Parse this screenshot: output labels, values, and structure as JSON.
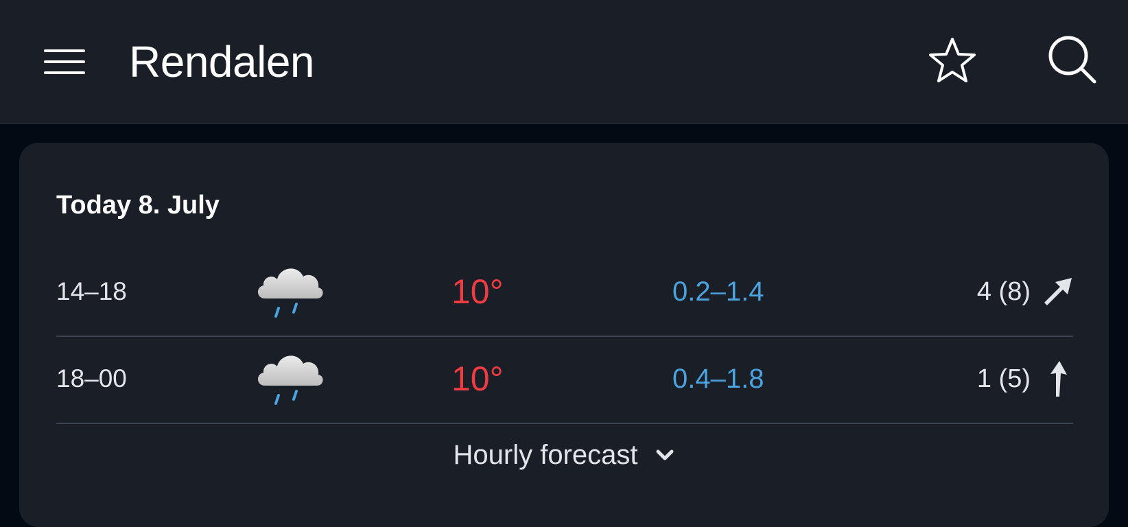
{
  "header": {
    "title": "Rendalen",
    "menu_icon": "hamburger-menu-icon",
    "favorite_icon": "star-outline-icon",
    "search_icon": "search-icon"
  },
  "forecast": {
    "day_title": "Today 8. July",
    "rows": [
      {
        "period": "14–18",
        "icon": "cloud-rain-icon",
        "temperature": "10°",
        "precipitation": "0.2–1.4",
        "wind": "4 (8)",
        "wind_direction": "north-east-arrow-icon"
      },
      {
        "period": "18–00",
        "icon": "cloud-rain-icon",
        "temperature": "10°",
        "precipitation": "0.4–1.8",
        "wind": "1 (5)",
        "wind_direction": "north-arrow-icon"
      }
    ],
    "hourly_label": "Hourly forecast",
    "hourly_icon": "chevron-down-icon"
  },
  "colors": {
    "background": "#030a14",
    "surface": "#1a1f27",
    "temperature": "#ef3c42",
    "precipitation": "#4ba3df",
    "text": "#e2e5ea"
  }
}
